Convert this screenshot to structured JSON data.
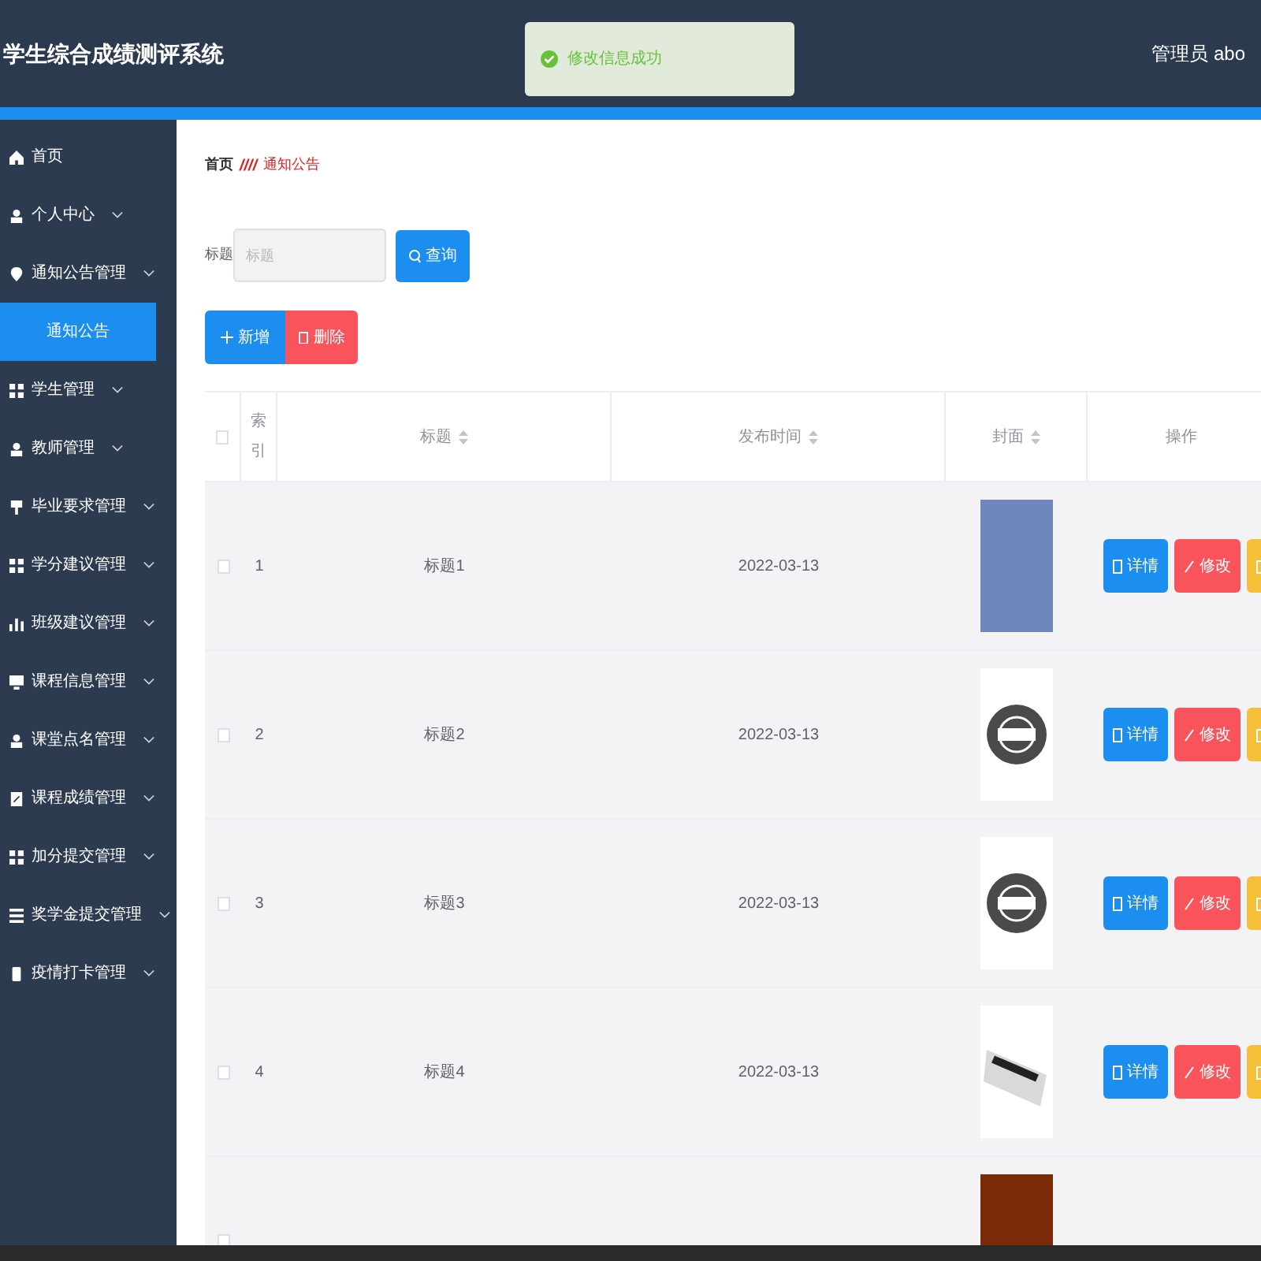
{
  "header": {
    "title": "学生综合成绩测评系统",
    "user": "管理员 abo"
  },
  "toast": {
    "message": "修改信息成功"
  },
  "sidebar": {
    "items": [
      {
        "label": "首页",
        "kind": "home",
        "expandable": false,
        "selected": false
      },
      {
        "label": "个人中心",
        "kind": "user",
        "expandable": true,
        "selected": false
      },
      {
        "label": "通知公告管理",
        "kind": "pin",
        "expandable": true,
        "selected": false,
        "children": [
          {
            "label": "通知公告",
            "selected": true
          }
        ]
      },
      {
        "label": "学生管理",
        "kind": "grid",
        "expandable": true,
        "selected": false
      },
      {
        "label": "教师管理",
        "kind": "user",
        "expandable": true,
        "selected": false
      },
      {
        "label": "毕业要求管理",
        "kind": "flag",
        "expandable": true,
        "selected": false
      },
      {
        "label": "学分建议管理",
        "kind": "grid",
        "expandable": true,
        "selected": false
      },
      {
        "label": "班级建议管理",
        "kind": "chart",
        "expandable": true,
        "selected": false
      },
      {
        "label": "课程信息管理",
        "kind": "monitor",
        "expandable": true,
        "selected": false
      },
      {
        "label": "课堂点名管理",
        "kind": "user",
        "expandable": true,
        "selected": false
      },
      {
        "label": "课程成绩管理",
        "kind": "doc",
        "expandable": true,
        "selected": false
      },
      {
        "label": "加分提交管理",
        "kind": "grid",
        "expandable": true,
        "selected": false
      },
      {
        "label": "奖学金提交管理",
        "kind": "list",
        "expandable": true,
        "selected": false
      },
      {
        "label": "疫情打卡管理",
        "kind": "phone",
        "expandable": true,
        "selected": false
      }
    ]
  },
  "breadcrumb": {
    "items": [
      "首页",
      "通知公告"
    ],
    "separator": "////"
  },
  "search": {
    "label": "标题",
    "placeholder": "标题",
    "button": "查询"
  },
  "actions": {
    "add": "新增",
    "delete": "删除"
  },
  "table": {
    "all_checked": false,
    "columns": [
      {
        "label": "索引",
        "sortable": false
      },
      {
        "label": "标题",
        "sortable": true
      },
      {
        "label": "发布时间",
        "sortable": true
      },
      {
        "label": "封面",
        "sortable": true
      },
      {
        "label": "操作",
        "sortable": false
      }
    ],
    "rows": [
      {
        "index": "1",
        "title": "标题1",
        "date": "2022-03-13",
        "cover": {
          "kind": "bbc"
        },
        "checked": false,
        "detail": "详情",
        "edit": "修改"
      },
      {
        "index": "2",
        "title": "标题2",
        "date": "2022-03-13",
        "cover": {
          "kind": "globe"
        },
        "checked": false,
        "detail": "详情",
        "edit": "修改"
      },
      {
        "index": "3",
        "title": "标题3",
        "date": "2022-03-13",
        "cover": {
          "kind": "globe"
        },
        "checked": false,
        "detail": "详情",
        "edit": "修改"
      },
      {
        "index": "4",
        "title": "标题4",
        "date": "2022-03-13",
        "cover": {
          "kind": "paper"
        },
        "checked": false,
        "detail": "详情",
        "edit": "修改"
      },
      {
        "cover": {
          "kind": "fire"
        },
        "checked": false
      }
    ]
  }
}
